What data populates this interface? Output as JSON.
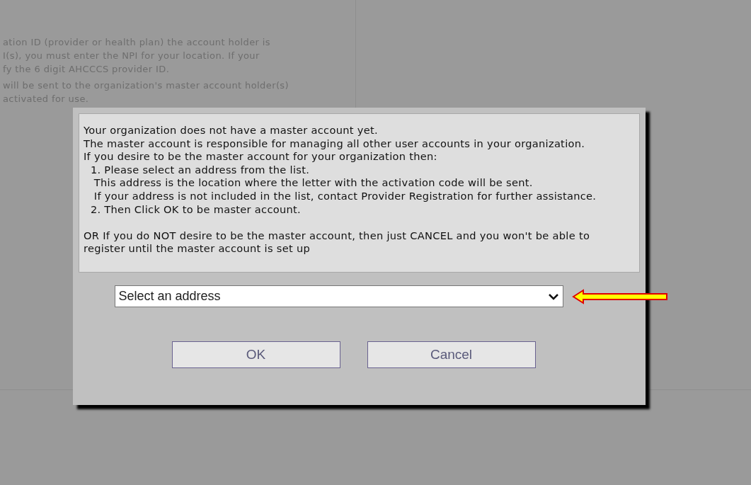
{
  "background_text": {
    "paragraphs": [
      [
        "ation ID (provider or health plan) the account holder is",
        "I(s), you must enter the NPI for your location. If your",
        "fy the 6 digit AHCCCS provider ID."
      ],
      [
        "will be sent to the organization's master account holder(s)",
        "activated for use."
      ]
    ]
  },
  "dialog": {
    "message_paragraphs": [
      [
        "Your organization does not have a master account yet.",
        "The master account is responsible for managing all other user accounts in your organization.",
        "If you desire to be the master account for your organization then:",
        "  1. Please select an address from the list.",
        "   This address is the location where the letter with the activation code will be sent.",
        "   If your address is not included in the list, contact Provider Registration for further assistance.",
        "  2. Then Click OK to be master account."
      ],
      [
        "OR If you do NOT desire to be the master account, then just CANCEL and you won't be able to",
        "register until the master account is set up"
      ]
    ],
    "address_select": {
      "value": "Select an address"
    },
    "buttons": [
      {
        "label": "OK"
      },
      {
        "label": "Cancel"
      }
    ]
  }
}
